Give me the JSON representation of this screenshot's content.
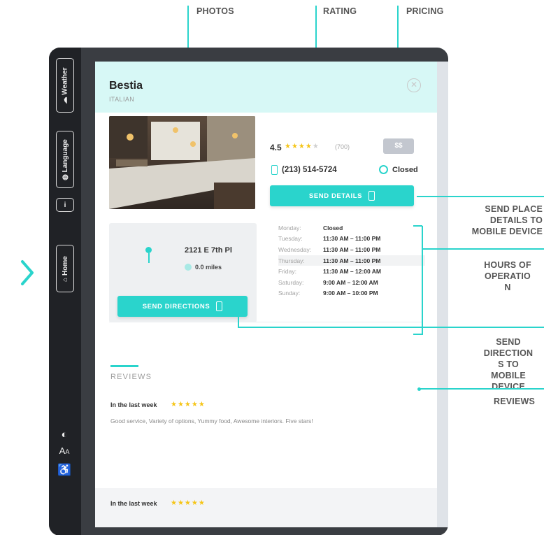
{
  "callouts": {
    "photos": "PHOTOS",
    "rating": "RATING",
    "pricing": "PRICING",
    "send_place_line1": "SEND PLACE",
    "send_place_line2": "DETAILS TO",
    "send_place_line3": "MOBILE DEVICE",
    "hours_line1": "HOURS OF",
    "hours_line2": "OPERATIO",
    "hours_line3": "N",
    "send_dir_line1": "SEND",
    "send_dir_line2": "DIRECTION",
    "send_dir_line3": "S TO",
    "send_dir_line4": "MOBILE",
    "send_dir_line5": "DEVICE",
    "reviews": "REVIEWS"
  },
  "sidebar": {
    "weather": "Weather",
    "language": "Language",
    "info": "i",
    "home": "Home"
  },
  "place": {
    "name": "Bestia",
    "category": "ITALIAN",
    "rating": "4.5",
    "rating_stars": 4.5,
    "review_count": "(700)",
    "price": "$$",
    "phone": "(213) 514-5724",
    "status": "Closed",
    "send_details_label": "SEND DETAILS",
    "address": "2121 E 7th Pl",
    "distance": "0.0 miles",
    "send_directions_label": "SEND DIRECTIONS"
  },
  "hours": [
    {
      "day": "Monday:",
      "time": "Closed"
    },
    {
      "day": "Tuesday:",
      "time": "11:30 AM – 11:00 PM"
    },
    {
      "day": "Wednesday:",
      "time": "11:30 AM – 11:00 PM"
    },
    {
      "day": "Thursday:",
      "time": "11:30 AM – 11:00 PM"
    },
    {
      "day": "Friday:",
      "time": "11:30 AM – 12:00 AM"
    },
    {
      "day": "Saturday:",
      "time": "9:00 AM – 12:00 AM"
    },
    {
      "day": "Sunday:",
      "time": "9:00 AM – 10:00 PM"
    }
  ],
  "reviews": {
    "title": "REVIEWS",
    "items": [
      {
        "period": "In the last week",
        "stars": "★★★★★",
        "text": "Good service, Variety of options, Yummy food, Awesome interiors. Five stars!"
      },
      {
        "period": "In the last week",
        "stars": "★★★★★"
      }
    ]
  },
  "colors": {
    "accent": "#2ad4cc",
    "header_bg": "#d7f8f6",
    "star": "#f5c518",
    "sidebar": "#202226"
  },
  "icons": [
    "chevron-right-icon",
    "weather-icon",
    "globe-icon",
    "info-icon",
    "home-icon",
    "contrast-icon",
    "text-size-icon",
    "accessibility-icon",
    "close-icon",
    "phone-icon",
    "clock-icon",
    "map-pin-icon",
    "distance-icon"
  ]
}
